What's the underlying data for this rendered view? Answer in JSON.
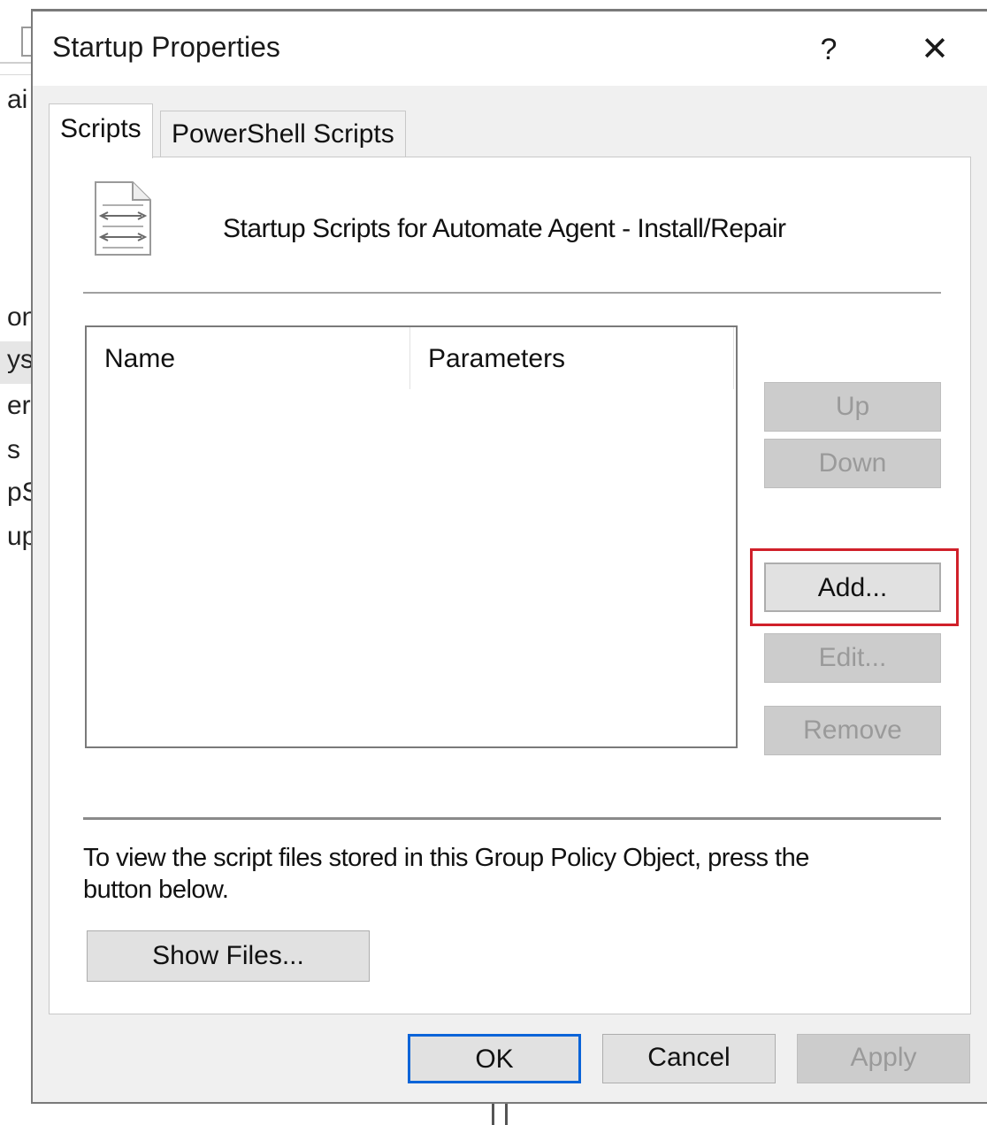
{
  "background": {
    "fragments": [
      "ai",
      "on",
      "ys",
      "ers",
      "s",
      "pS",
      "up"
    ]
  },
  "dialog": {
    "title": "Startup Properties",
    "help_label": "?",
    "close_label": "✕",
    "tabs": [
      {
        "label": "Scripts",
        "active": true
      },
      {
        "label": "PowerShell Scripts",
        "active": false
      }
    ],
    "heading": "Startup Scripts for Automate Agent - Install/Repair",
    "list": {
      "columns": [
        "Name",
        "Parameters"
      ],
      "rows": []
    },
    "side_buttons": {
      "up": "Up",
      "down": "Down",
      "add": "Add...",
      "edit": "Edit...",
      "remove": "Remove"
    },
    "info_text": "To view the script files stored in this Group Policy Object, press the button below.",
    "show_files_label": "Show Files...",
    "footer": {
      "ok": "OK",
      "cancel": "Cancel",
      "apply": "Apply"
    },
    "colors": {
      "highlight": "#d0202a",
      "default_button_border": "#0a64d8",
      "disabled_text": "#9a9a9a"
    }
  }
}
